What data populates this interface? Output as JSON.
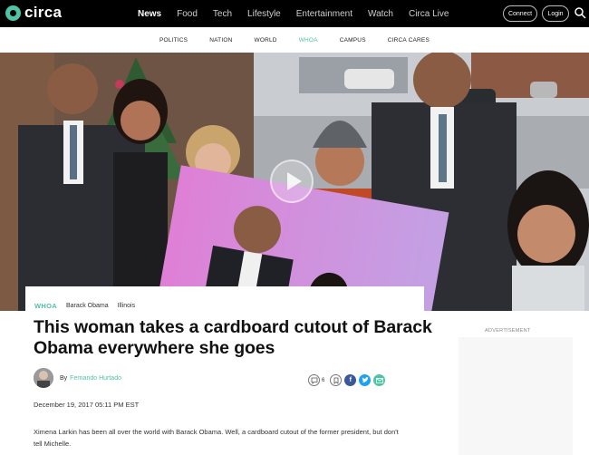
{
  "brand": {
    "logo_text": "circa",
    "accent": "#4fc3a5"
  },
  "topnav": {
    "items": [
      {
        "label": "News",
        "active": true
      },
      {
        "label": "Food"
      },
      {
        "label": "Tech"
      },
      {
        "label": "Lifestyle"
      },
      {
        "label": "Entertainment"
      },
      {
        "label": "Watch"
      },
      {
        "label": "Circa Live"
      }
    ],
    "connect_label": "Connect",
    "login_label": "Login",
    "search_icon": "search-icon"
  },
  "subnav": {
    "items": [
      {
        "label": "POLITICS"
      },
      {
        "label": "NATION"
      },
      {
        "label": "WORLD"
      },
      {
        "label": "WHOA",
        "active": true
      },
      {
        "label": "CAMPUS"
      },
      {
        "label": "CIRCA CARES"
      }
    ]
  },
  "hero": {
    "media_icon": "play-icon"
  },
  "article": {
    "tags": [
      "WHOA",
      "Barack Obama",
      "Illinois"
    ],
    "headline": "This woman takes a cardboard cutout of Barack Obama everywhere she goes",
    "byline_prefix": "By",
    "author": "Fernando Hurtado",
    "comment_count": "6",
    "share_icons": [
      "comment-icon",
      "bookmark-icon",
      "facebook-icon",
      "twitter-icon",
      "email-icon"
    ],
    "date": "December 19, 2017 05:11 PM EST",
    "lede": "Ximena Larkin has been all over the world with Barack Obama. Well, a cardboard cutout of the former president, but don't tell Michelle."
  },
  "sidebar": {
    "ad_label": "ADVERTISEMENT"
  }
}
